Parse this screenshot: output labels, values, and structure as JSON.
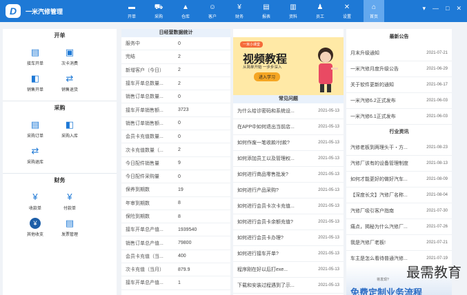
{
  "app": {
    "title": "一米汽修管理",
    "logo_glyph": "D"
  },
  "nav": [
    {
      "label": "开单",
      "icon": "car-icon",
      "glyph": "▬"
    },
    {
      "label": "采购",
      "icon": "cart-icon",
      "glyph": "⛟"
    },
    {
      "label": "仓库",
      "icon": "warehouse-icon",
      "glyph": "▲"
    },
    {
      "label": "客户",
      "icon": "customer-icon",
      "glyph": "☺"
    },
    {
      "label": "财务",
      "icon": "yen-icon",
      "glyph": "¥"
    },
    {
      "label": "报表",
      "icon": "report-icon",
      "glyph": "▤"
    },
    {
      "label": "资料",
      "icon": "document-icon",
      "glyph": "▥"
    },
    {
      "label": "员工",
      "icon": "staff-icon",
      "glyph": "♟"
    },
    {
      "label": "设置",
      "icon": "wrench-icon",
      "glyph": "✕"
    },
    {
      "label": "首页",
      "icon": "home-icon",
      "glyph": "⌂"
    }
  ],
  "window_controls": {
    "menu": "▾",
    "minimize": "—",
    "maximize": "□",
    "close": "✕"
  },
  "quick": {
    "kaidan": {
      "title": "开单",
      "items": [
        {
          "label": "接车开单",
          "glyph": "▤"
        },
        {
          "label": "次卡消费",
          "glyph": "▣"
        },
        {
          "label": "销售开单",
          "glyph": "◧"
        },
        {
          "label": "销售退货",
          "glyph": "⇄"
        }
      ]
    },
    "caigou": {
      "title": "采购",
      "items": [
        {
          "label": "采购订单",
          "glyph": "▤"
        },
        {
          "label": "采购入库",
          "glyph": "◧"
        },
        {
          "label": "采购退库",
          "glyph": "⇄"
        }
      ]
    },
    "caiwu": {
      "title": "财务",
      "items": [
        {
          "label": "收款单",
          "glyph": "¥"
        },
        {
          "label": "付款单",
          "glyph": "¥"
        },
        {
          "label": "其他收支",
          "glyph": "¥"
        },
        {
          "label": "发票管理",
          "glyph": "▤"
        }
      ]
    }
  },
  "stats": {
    "title": "日经营数据统计",
    "rows": [
      {
        "k": "服务中",
        "v": "0"
      },
      {
        "k": "完结",
        "v": "2"
      },
      {
        "k": "新增客户（今日）",
        "v": "2"
      },
      {
        "k": "接车开单总数量...",
        "v": "2"
      },
      {
        "k": "销售订单总数量...",
        "v": "0"
      },
      {
        "k": "接车开单销售额...",
        "v": "3723"
      },
      {
        "k": "销售订单销售额...",
        "v": "0"
      },
      {
        "k": "会员卡充值数量...",
        "v": "0"
      },
      {
        "k": "次卡充值数量（...",
        "v": "2"
      },
      {
        "k": "今日配件销售量",
        "v": "9"
      },
      {
        "k": "今日配件采购量",
        "v": "0"
      },
      {
        "k": "保养到期数",
        "v": "19"
      },
      {
        "k": "年审到期数",
        "v": "8"
      },
      {
        "k": "保险到期数",
        "v": "8"
      },
      {
        "k": "接车开单总产值...",
        "v": "1939540"
      },
      {
        "k": "销售订单总产值...",
        "v": "79800"
      },
      {
        "k": "会员卡充值（当...",
        "v": "400"
      },
      {
        "k": "次卡充值（当月）",
        "v": "879.9"
      },
      {
        "k": "接车开单总产值...",
        "v": "1"
      }
    ]
  },
  "banner": {
    "ribbon": "一米小课堂",
    "title": "视频教程",
    "subtitle": "从简单开始 一步步深入",
    "button": "进入学习"
  },
  "faq": {
    "title": "常见问题",
    "rows": [
      {
        "t": "为什么给诊密码和系统设...",
        "d": "2021-05-13"
      },
      {
        "t": "在APP中如何退出当前店...",
        "d": "2021-05-13"
      },
      {
        "t": "如何作废一笔收款/付款?",
        "d": "2021-05-13"
      },
      {
        "t": "如何添加员工以及管理权...",
        "d": "2021-05-13"
      },
      {
        "t": "如何进行商品零售批发?",
        "d": "2021-05-13"
      },
      {
        "t": "如何进行产品采购?",
        "d": "2021-05-13"
      },
      {
        "t": "如何进行会员卡次卡充值...",
        "d": "2021-05-13"
      },
      {
        "t": "如何进行会员卡余额充值?",
        "d": "2021-05-13"
      },
      {
        "t": "如何进行会员卡办理?",
        "d": "2021-05-13"
      },
      {
        "t": "如何进行接车开单?",
        "d": "2021-05-13"
      },
      {
        "t": "程序刚在好以后打exe...",
        "d": "2021-05-13"
      },
      {
        "t": "下载和安装过程遇到了示...",
        "d": "2021-05-13"
      }
    ]
  },
  "announce": {
    "title": "最新公告",
    "rows": [
      {
        "t": "月末升级通知",
        "d": "2021-07-21"
      },
      {
        "t": "一米汽修月度升级公告",
        "d": "2021-06-29"
      },
      {
        "t": "关于软件更新的通知",
        "d": "2021-06-17"
      },
      {
        "t": "一米汽修6.2正式发布",
        "d": "2021-06-03"
      },
      {
        "t": "一米汽修6.1正式发布",
        "d": "2021-06-03"
      }
    ]
  },
  "industry": {
    "title": "行业资讯",
    "rows": [
      {
        "t": "汽修老板到两理头干・方...",
        "d": "2021-08-23"
      },
      {
        "t": "汽修厂该有的设备管理制度",
        "d": "2021-08-13"
      },
      {
        "t": "如何才能更好的做好汽车...",
        "d": "2021-08-09"
      },
      {
        "t": "【深度长文】汽修厂名称...",
        "d": "2021-08-04"
      },
      {
        "t": "汽修厂吸引客户指南",
        "d": "2021-07-30"
      },
      {
        "t": "痛点，揭秘为什么汽修厂...",
        "d": "2021-07-26"
      },
      {
        "t": "我是汽修厂老板!",
        "d": "2021-07-21"
      },
      {
        "t": "车主是怎么看待普通汽修...",
        "d": "2021-07-19"
      }
    ]
  },
  "promo": {
    "small": "将发现?",
    "text": "免费定制业务流程"
  },
  "watermark": "最需教育"
}
